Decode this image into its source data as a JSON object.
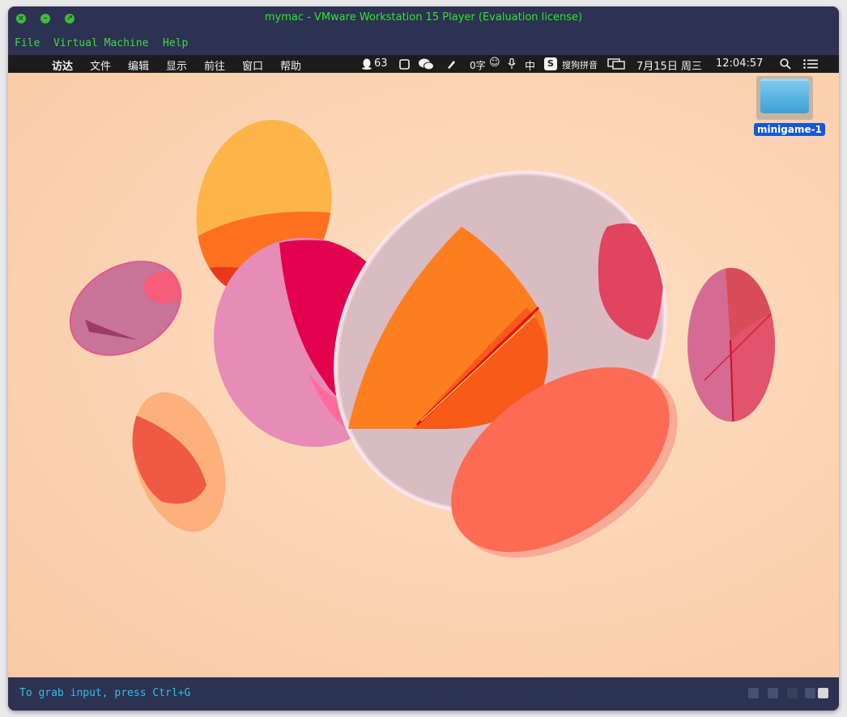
{
  "window": {
    "title": "mymac - VMware Workstation 15 Player (Evaluation license)",
    "controls": {
      "close_glyph": "×",
      "minimize_glyph": "–",
      "zoom_glyph": "↗"
    }
  },
  "vm_menu": {
    "items": [
      "File",
      "Virtual Machine",
      "Help"
    ]
  },
  "mac_menubar": {
    "apple_glyph": "",
    "app_name": "访达",
    "items": [
      "文件",
      "编辑",
      "显示",
      "前往",
      "窗口",
      "帮助"
    ],
    "status": {
      "qq_count": "63",
      "word_count": "0字",
      "input_lang": "中",
      "input_method": "搜狗拼音",
      "date": "7月15日 周三",
      "time": "12:04:57"
    }
  },
  "desktop": {
    "icons": [
      {
        "label": "minigame-1",
        "icon": "folder-icon"
      }
    ]
  },
  "status_bar": {
    "message": "To grab input, press Ctrl+G"
  },
  "colors": {
    "chrome": "#2d3152",
    "vm_text": "#3ddc3d",
    "status_text": "#29c2e8",
    "wallpaper": "#fbd3b2"
  }
}
